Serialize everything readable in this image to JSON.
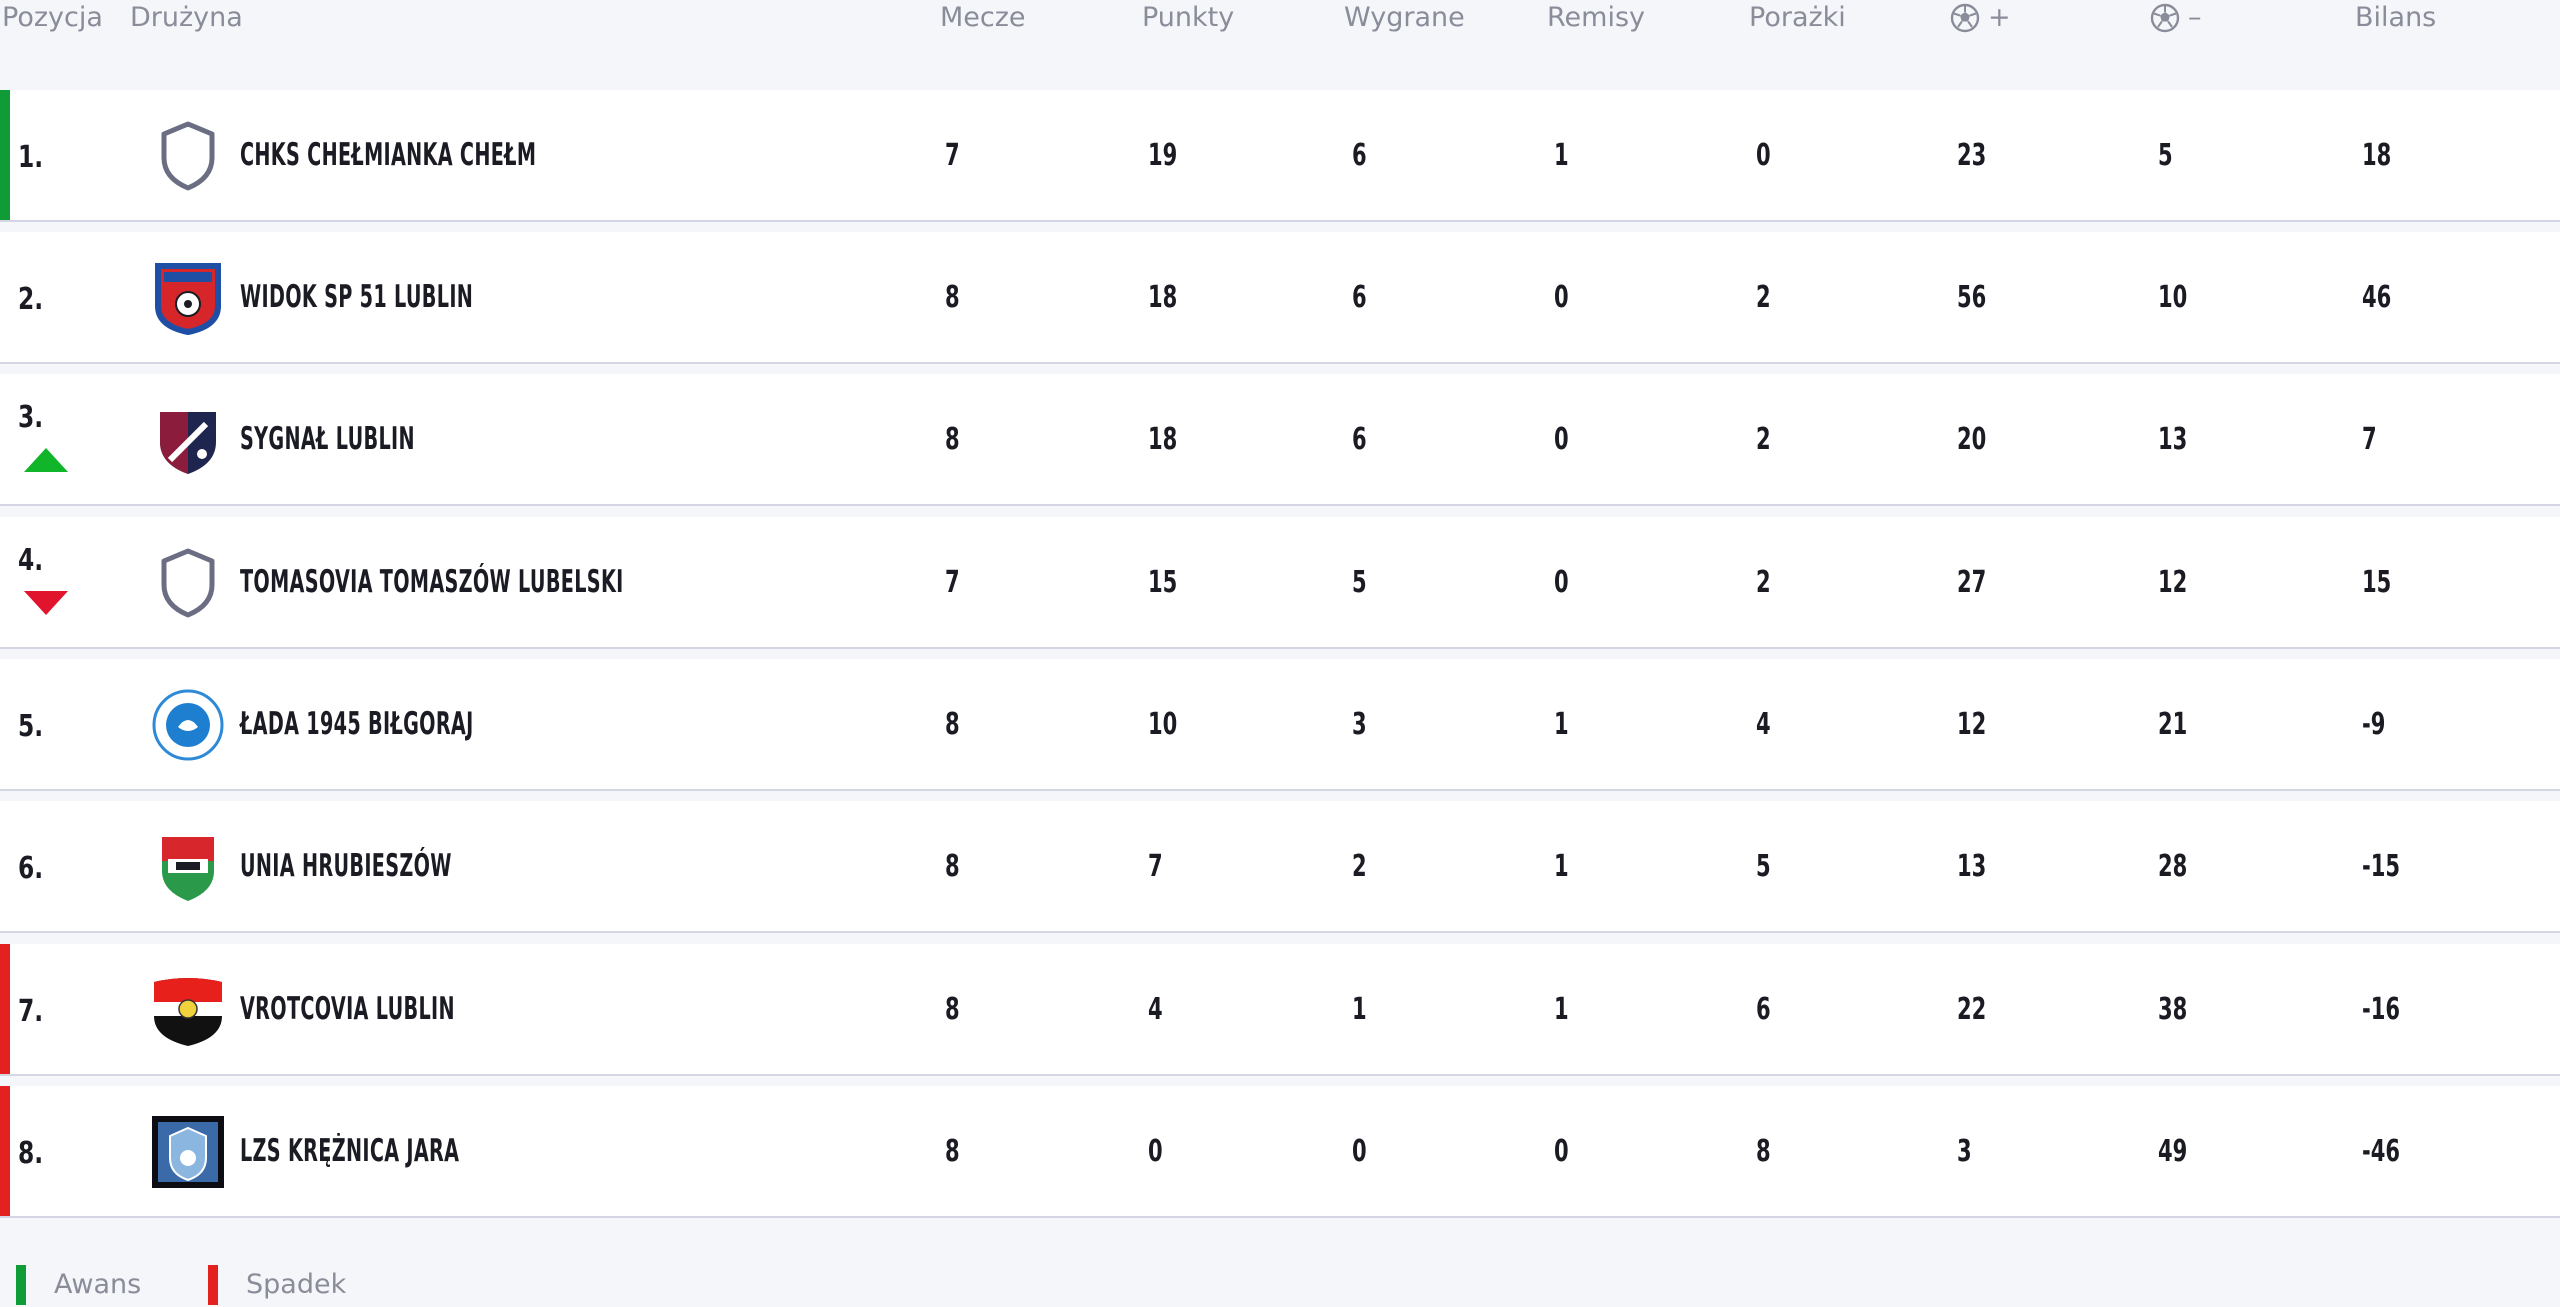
{
  "headers": {
    "position": "Pozycja",
    "team": "Drużyna",
    "played": "Mecze",
    "points": "Punkty",
    "wins": "Wygrane",
    "draws": "Remisy",
    "losses": "Porażki",
    "goals_for": "+",
    "goals_against": "–",
    "balance": "Bilans"
  },
  "rows": [
    {
      "pos": "1.",
      "team": "CHKS CHEŁMIANKA CHEŁM",
      "crest": "shield-placeholder",
      "status": "promotion",
      "trend": "",
      "played": "7",
      "points": "19",
      "wins": "6",
      "draws": "1",
      "losses": "0",
      "gf": "23",
      "ga": "5",
      "balance": "18"
    },
    {
      "pos": "2.",
      "team": "WIDOK SP 51 LUBLIN",
      "crest": "widok-crest",
      "status": "",
      "trend": "",
      "played": "8",
      "points": "18",
      "wins": "6",
      "draws": "0",
      "losses": "2",
      "gf": "56",
      "ga": "10",
      "balance": "46"
    },
    {
      "pos": "3.",
      "team": "SYGNAŁ LUBLIN",
      "crest": "sygnal-crest",
      "status": "",
      "trend": "up",
      "played": "8",
      "points": "18",
      "wins": "6",
      "draws": "0",
      "losses": "2",
      "gf": "20",
      "ga": "13",
      "balance": "7"
    },
    {
      "pos": "4.",
      "team": "TOMASOVIA TOMASZÓW LUBELSKI",
      "crest": "shield-placeholder",
      "status": "",
      "trend": "down",
      "played": "7",
      "points": "15",
      "wins": "5",
      "draws": "0",
      "losses": "2",
      "gf": "27",
      "ga": "12",
      "balance": "15"
    },
    {
      "pos": "5.",
      "team": "ŁADA 1945 BIŁGORAJ",
      "crest": "lada-crest",
      "status": "",
      "trend": "",
      "played": "8",
      "points": "10",
      "wins": "3",
      "draws": "1",
      "losses": "4",
      "gf": "12",
      "ga": "21",
      "balance": "-9"
    },
    {
      "pos": "6.",
      "team": "UNIA HRUBIESZÓW",
      "crest": "unia-crest",
      "status": "",
      "trend": "",
      "played": "8",
      "points": "7",
      "wins": "2",
      "draws": "1",
      "losses": "5",
      "gf": "13",
      "ga": "28",
      "balance": "-15"
    },
    {
      "pos": "7.",
      "team": "VROTCOVIA LUBLIN",
      "crest": "vrotcovia-crest",
      "status": "relegation",
      "trend": "",
      "played": "8",
      "points": "4",
      "wins": "1",
      "draws": "1",
      "losses": "6",
      "gf": "22",
      "ga": "38",
      "balance": "-16"
    },
    {
      "pos": "8.",
      "team": "LZS KRĘŻNICA JARA",
      "crest": "krieznica-crest",
      "status": "relegation",
      "trend": "",
      "played": "8",
      "points": "0",
      "wins": "0",
      "draws": "0",
      "losses": "8",
      "gf": "3",
      "ga": "49",
      "balance": "-46"
    }
  ],
  "legend": {
    "promotion": "Awans",
    "relegation": "Spadek"
  },
  "colors": {
    "promotion": "#0f9b36",
    "relegation": "#e42121",
    "trend_up": "#11b52a",
    "trend_down": "#e0142c"
  }
}
